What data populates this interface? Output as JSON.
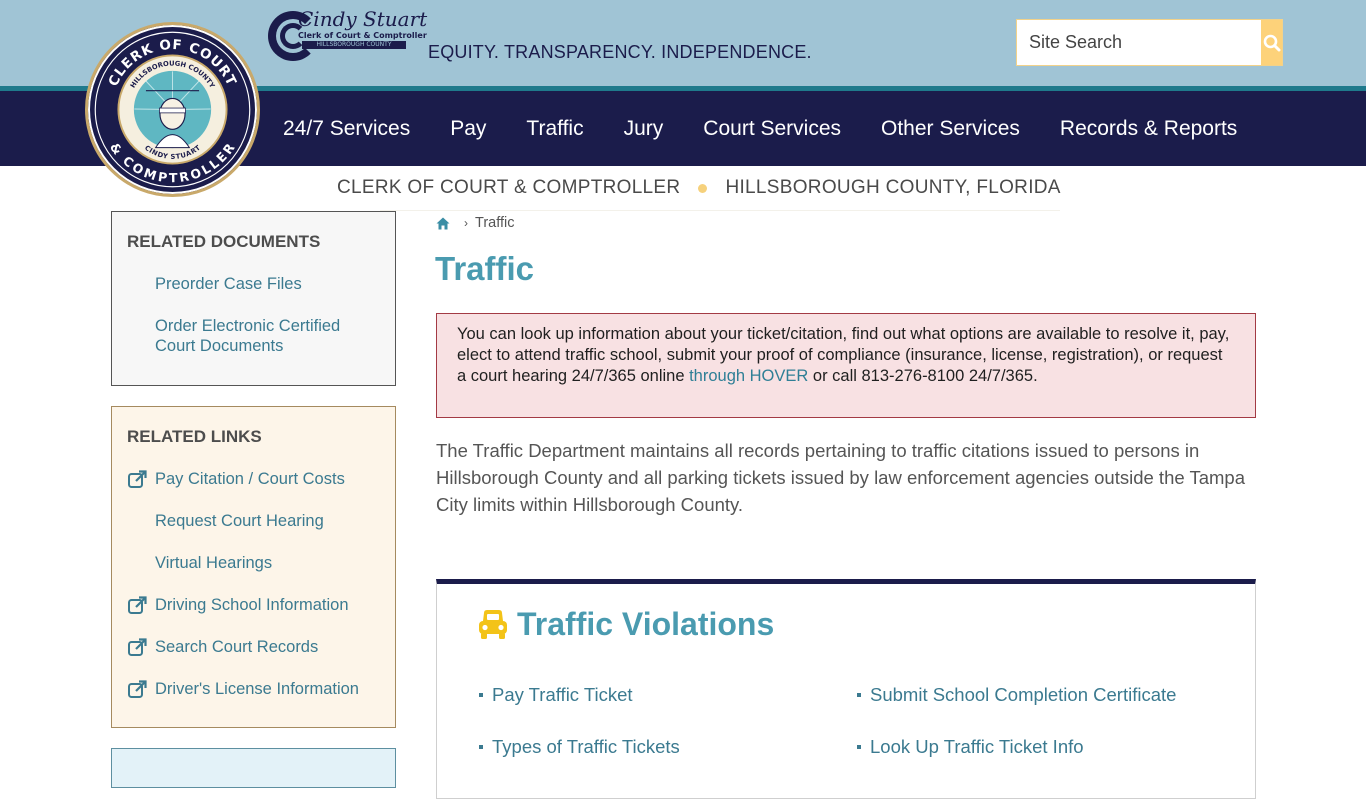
{
  "header": {
    "seal": {
      "outer_top": "CLERK OF COURT",
      "outer_bottom": "& COMPTROLLER",
      "inner_top": "HILLSBOROUGH COUNTY",
      "inner_bottom": "CINDY STUART"
    },
    "brand": {
      "name": "Cindy Stuart",
      "subtitle": "Clerk of Court & Comptroller",
      "county": "HILLSBOROUGH COUNTY"
    },
    "tagline": "EQUITY. TRANSPARENCY. INDEPENDENCE.",
    "search": {
      "placeholder": "Site Search",
      "button_icon": "search-icon"
    },
    "colors": {
      "topbar": "#a0c4d5",
      "navbar": "#1b1c4b",
      "accent_teal": "#4a9bb0",
      "accent_yellow": "#fdd27a"
    }
  },
  "nav": {
    "items": [
      {
        "label": "24/7 Services"
      },
      {
        "label": "Pay"
      },
      {
        "label": "Traffic"
      },
      {
        "label": "Jury"
      },
      {
        "label": "Court Services"
      },
      {
        "label": "Other Services"
      },
      {
        "label": "Records & Reports"
      }
    ]
  },
  "subheader": {
    "left": "CLERK OF COURT & COMPTROLLER",
    "right": "HILLSBOROUGH COUNTY, FLORIDA"
  },
  "sidebar": {
    "related_documents": {
      "title": "RELATED DOCUMENTS",
      "items": [
        {
          "label": "Preorder Case Files",
          "external": false
        },
        {
          "label": "Order Electronic Certified Court Documents",
          "external": false
        }
      ]
    },
    "related_links": {
      "title": "RELATED LINKS",
      "items": [
        {
          "label": "Pay Citation / Court Costs",
          "external": true
        },
        {
          "label": "Request Court Hearing",
          "external": false
        },
        {
          "label": "Virtual Hearings",
          "external": false
        },
        {
          "label": "Driving School Information",
          "external": true
        },
        {
          "label": "Search Court Records",
          "external": true
        },
        {
          "label": "Driver's License Information",
          "external": true
        }
      ]
    }
  },
  "main": {
    "breadcrumb": {
      "home_icon": "home-icon",
      "current": "Traffic"
    },
    "title": "Traffic",
    "alert": {
      "text_before": "You can look up information about your ticket/citation, find out what options are available to resolve it, pay, elect to attend traffic school, submit your proof of compliance (insurance, license, registration), or request a court hearing 24/7/365 online ",
      "link": "through HOVER",
      "text_after": " or call 813-276-8100 24/7/365."
    },
    "intro": "The Traffic Department maintains all records pertaining to traffic citations issued to persons in Hillsborough County and all parking tickets issued by law enforcement agencies outside the Tampa City limits within Hillsborough County.",
    "card": {
      "icon": "car-icon",
      "title": "Traffic Violations",
      "links": [
        {
          "label": "Pay Traffic Ticket"
        },
        {
          "label": "Submit School Completion Certificate"
        },
        {
          "label": "Types of Traffic Tickets"
        },
        {
          "label": "Look Up Traffic Ticket Info"
        }
      ]
    }
  }
}
